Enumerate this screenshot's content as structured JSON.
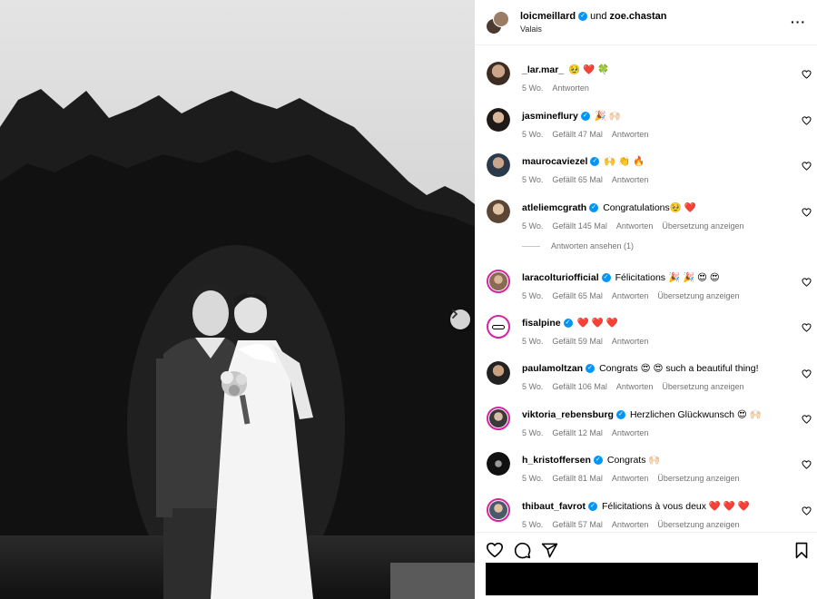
{
  "header": {
    "user1": "loicmeillard",
    "connector": "und",
    "user2": "zoe.chastan",
    "location": "Valais"
  },
  "comments": [
    {
      "user": "_lar.mar_",
      "verified": false,
      "text": "🥹 ❤️ 🍀",
      "time": "5 Wo.",
      "likes": "",
      "reply": "Antworten",
      "translate": ""
    },
    {
      "user": "jasmineflury",
      "verified": true,
      "text": "🎉 🙌🏻",
      "time": "5 Wo.",
      "likes": "Gefällt 47 Mal",
      "reply": "Antworten",
      "translate": ""
    },
    {
      "user": "maurocaviezel",
      "verified": true,
      "text": "🙌 👏 🔥",
      "time": "5 Wo.",
      "likes": "Gefällt 65 Mal",
      "reply": "Antworten",
      "translate": ""
    },
    {
      "user": "atleliemcgrath",
      "verified": true,
      "text": "Congratulations🥹 ❤️",
      "time": "5 Wo.",
      "likes": "Gefällt 145 Mal",
      "reply": "Antworten",
      "translate": "Übersetzung anzeigen"
    },
    {
      "user": "laracolturiofficial",
      "verified": true,
      "text": "Félicitations 🎉 🎉 😍 😍",
      "time": "5 Wo.",
      "likes": "Gefällt 65 Mal",
      "reply": "Antworten",
      "translate": "Übersetzung anzeigen"
    },
    {
      "user": "fisalpine",
      "verified": true,
      "text": "❤️ ❤️ ❤️",
      "time": "5 Wo.",
      "likes": "Gefällt 59 Mal",
      "reply": "Antworten",
      "translate": ""
    },
    {
      "user": "paulamoltzan",
      "verified": true,
      "text": "Congrats 😍 😍  such a beautiful thing!",
      "time": "5 Wo.",
      "likes": "Gefällt 106 Mal",
      "reply": "Antworten",
      "translate": "Übersetzung anzeigen"
    },
    {
      "user": "viktoria_rebensburg",
      "verified": true,
      "text": "Herzlichen Glückwunsch 😍 🙌🏻",
      "time": "5 Wo.",
      "likes": "Gefällt 12 Mal",
      "reply": "Antworten",
      "translate": ""
    },
    {
      "user": "h_kristoffersen",
      "verified": true,
      "text": "Congrats 🙌🏻",
      "time": "5 Wo.",
      "likes": "Gefällt 81 Mal",
      "reply": "Antworten",
      "translate": "Übersetzung anzeigen"
    },
    {
      "user": "thibaut_favrot",
      "verified": true,
      "text": "Félicitations à vous deux ❤️ ❤️ ❤️",
      "time": "5 Wo.",
      "likes": "Gefällt 57 Mal",
      "reply": "Antworten",
      "translate": "Übersetzung anzeigen"
    }
  ],
  "view_replies": "Antworten ansehen (1)",
  "colors": {
    "verified": "#0095f6",
    "meta": "#737373",
    "story_ring": "#d6249f"
  },
  "icons": [
    "more-icon",
    "heart-icon",
    "comment-icon",
    "share-icon",
    "bookmark-icon",
    "chevron-right-icon",
    "verified-icon"
  ]
}
